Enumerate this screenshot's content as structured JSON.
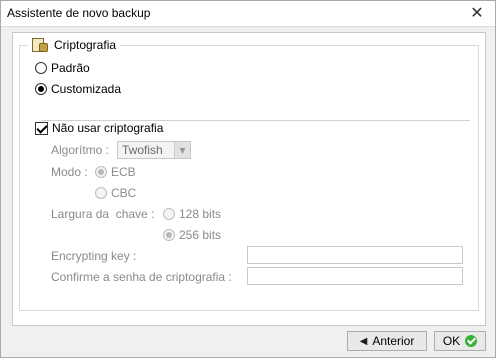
{
  "window": {
    "title": "Assistente de novo backup",
    "close_glyph": "✕"
  },
  "group": {
    "legend": "Criptografia",
    "icon": "encryption-icon"
  },
  "mode_options": {
    "padrao": {
      "label": "Padrão",
      "checked": false
    },
    "customizada": {
      "label": "Customizada",
      "checked": true
    }
  },
  "no_encryption": {
    "label": "Não usar criptografia",
    "checked": true
  },
  "algorithm": {
    "label": "Algorítmo :",
    "value": "Twofish",
    "arrow": "▼"
  },
  "mode": {
    "label": "Modo :",
    "options": [
      {
        "label": "ECB",
        "checked": true
      },
      {
        "label": "CBC",
        "checked": false
      }
    ]
  },
  "key_width": {
    "label": "Largura da  chave :",
    "options": [
      {
        "label": "128 bits",
        "checked": false
      },
      {
        "label": "256 bits",
        "checked": true
      }
    ]
  },
  "encrypting_key": {
    "label": "Encrypting key :",
    "value": ""
  },
  "confirm_key": {
    "label": "Confirme a senha de criptografia :",
    "value": ""
  },
  "buttons": {
    "back": {
      "label": "Anterior",
      "glyph": "◀"
    },
    "ok": {
      "label": "OK"
    }
  },
  "colors": {
    "ok_icon": "#3cae3a",
    "disabled_text": "#8a8a8a"
  }
}
